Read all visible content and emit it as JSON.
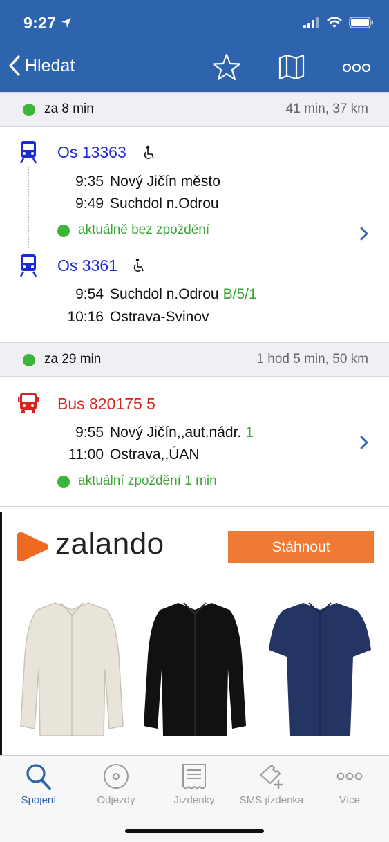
{
  "status_bar": {
    "time": "9:27"
  },
  "nav": {
    "back_label": "Hledat",
    "icons": [
      "star-icon",
      "map-icon",
      "more-icon"
    ]
  },
  "colors": {
    "header_blue": "#2e64ad",
    "train_blue": "#1a2ad6",
    "bus_red": "#d8241f",
    "status_green": "#3db53a",
    "ad_orange": "#ef7a35"
  },
  "connections": [
    {
      "header": {
        "departs_in": "za 8 min",
        "summary": "41 min, 37 km"
      },
      "legs": [
        {
          "vehicle": "train-icon",
          "line": "Os 13363",
          "stops": [
            {
              "time": "9:35",
              "station": "Nový Jičín město",
              "platform": ""
            },
            {
              "time": "9:49",
              "station": "Suchdol n.Odrou",
              "platform": ""
            }
          ],
          "status": "aktuálně bez zpoždění"
        },
        {
          "vehicle": "train-icon",
          "line": "Os 3361",
          "stops": [
            {
              "time": "9:54",
              "station": "Suchdol n.Odrou",
              "platform": "B/5/1"
            },
            {
              "time": "10:16",
              "station": "Ostrava-Svinov",
              "platform": ""
            }
          ]
        }
      ]
    },
    {
      "header": {
        "departs_in": "za 29 min",
        "summary": "1 hod 5 min, 50 km"
      },
      "legs": [
        {
          "vehicle": "bus-icon",
          "line": "Bus 820175 5",
          "stops": [
            {
              "time": "9:55",
              "station": "Nový Jičín,,aut.nádr.",
              "platform": "1"
            },
            {
              "time": "11:00",
              "station": "Ostrava,,ÚAN",
              "platform": ""
            }
          ],
          "status": "aktuální zpoždění 1 min"
        }
      ]
    }
  ],
  "ad": {
    "brand": "zalando",
    "button": "Stáhnout"
  },
  "tabbar": {
    "items": [
      {
        "label": "Spojení",
        "icon": "search-icon",
        "active": true
      },
      {
        "label": "Odjezdy",
        "icon": "disc-icon"
      },
      {
        "label": "Jízdenky",
        "icon": "ticket-icon"
      },
      {
        "label": "SMS jízdenka",
        "icon": "sms-ticket-icon"
      },
      {
        "label": "Více",
        "icon": "more-icon"
      }
    ]
  }
}
